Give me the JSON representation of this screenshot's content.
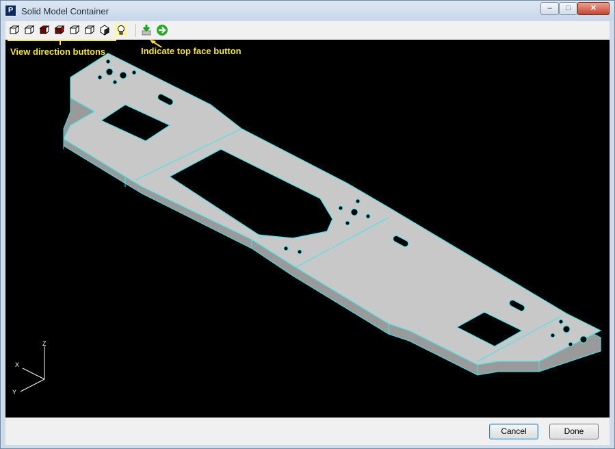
{
  "window": {
    "title": "Solid Model Container",
    "app_icon_text": "P",
    "controls": {
      "minimize": "–",
      "maximize": "□",
      "close": "✕"
    }
  },
  "toolbar": {
    "buttons": [
      {
        "name": "view-front-icon"
      },
      {
        "name": "view-back-icon"
      },
      {
        "name": "view-top-icon"
      },
      {
        "name": "view-bottom-icon"
      },
      {
        "name": "view-left-icon"
      },
      {
        "name": "view-right-icon"
      },
      {
        "name": "view-isometric-icon"
      },
      {
        "name": "lightbulb-icon"
      },
      {
        "name": "indicate-top-face-icon"
      },
      {
        "name": "go-arrow-icon"
      }
    ]
  },
  "annotations": {
    "view_direction": "View direction buttons",
    "top_face": "Indicate top face button"
  },
  "axes": {
    "x": "X",
    "y": "Y",
    "z": "Z"
  },
  "footer": {
    "cancel": "Cancel",
    "done": "Done"
  },
  "colors": {
    "edge": "#3fe6ec",
    "face": "#c8c8c8",
    "annotation": "#f5e43a",
    "background": "#000000"
  }
}
